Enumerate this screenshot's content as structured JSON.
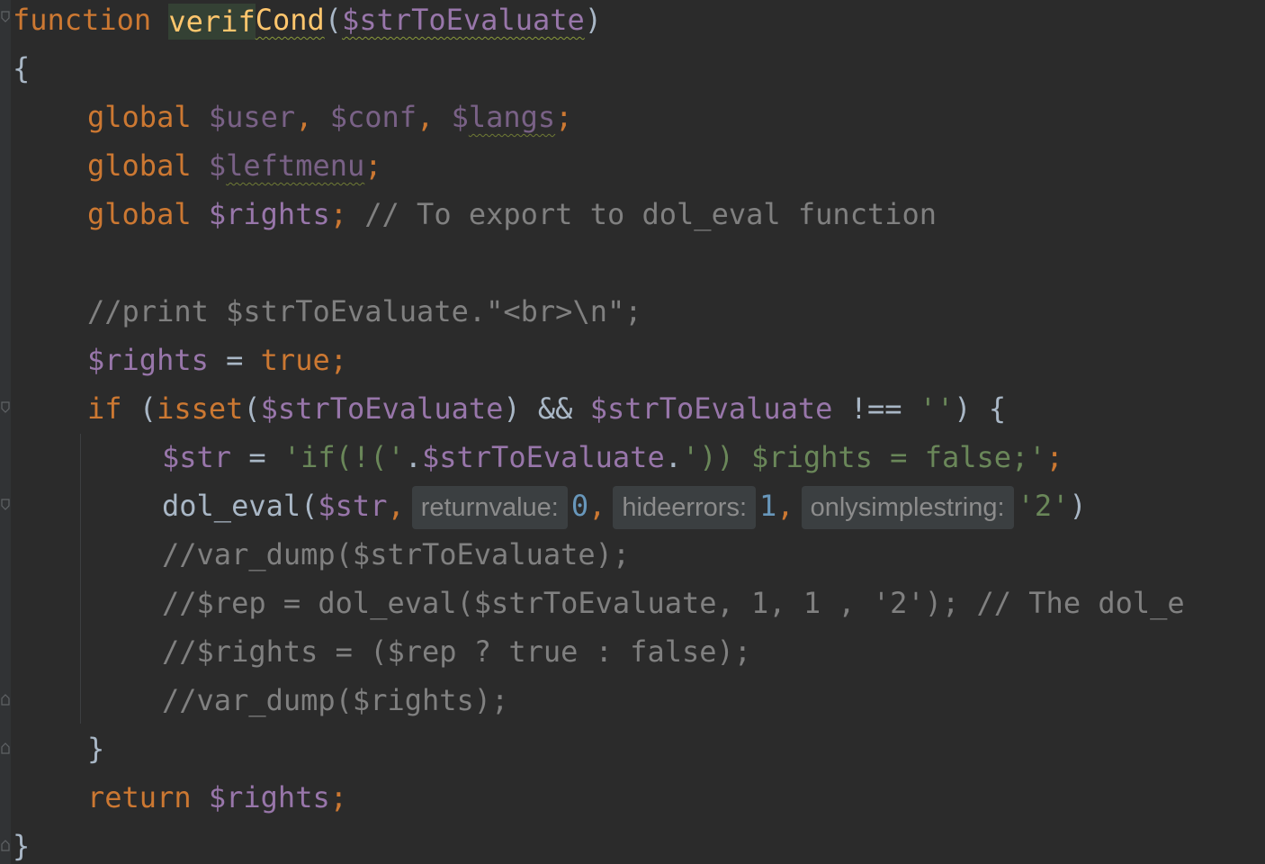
{
  "editor": {
    "background": "#2b2b2b",
    "colors": {
      "keyword": "#cc7832",
      "function_name": "#ffc66d",
      "variable": "#9876aa",
      "string": "#6a8759",
      "number": "#6897bb",
      "comment": "#808080",
      "default": "#a9b7c6"
    },
    "code": {
      "l1": {
        "kw": "function",
        "fname_a": "verif",
        "fname_b": "Cond",
        "open": "(",
        "param": "$strToEvaluate",
        "close": ")"
      },
      "l2": {
        "brace": "{"
      },
      "l3": {
        "kw": "global",
        "v1": "$user",
        "sep1": ", ",
        "v2": "$conf",
        "sep2": ", ",
        "v3_dollar": "$",
        "v3_name": "langs",
        "semi": ";"
      },
      "l4": {
        "kw": "global",
        "v_dollar": "$",
        "v_name": "leftmenu",
        "semi": ";"
      },
      "l5": {
        "kw": "global",
        "v": "$rights",
        "semi": ";",
        "comment": "// To export to dol_eval function"
      },
      "l6": {
        "comment": "//print $strToEvaluate.\"<br>\\n\";"
      },
      "l7": {
        "v": "$rights",
        "op": " = ",
        "val": "true",
        "semi": ";"
      },
      "l8": {
        "kw": "if",
        "p1": " (",
        "fn": "isset",
        "p2": "(",
        "v1": "$strToEvaluate",
        "p3": ") && ",
        "v2": "$strToEvaluate",
        "p4": " !== ",
        "s": "''",
        "p5": ") {"
      },
      "l9": {
        "v": "$str",
        "op": " = ",
        "s1": "'if(!('",
        "dot1": ".",
        "v2": "$strToEvaluate",
        "dot2": ".",
        "s2": "')) $rights = false;'",
        "semi": ";"
      },
      "l10": {
        "fn": "dol_eval",
        "p1": "(",
        "v": "$str",
        "c1": ",",
        "hint1": "returnvalue:",
        "n1": "0",
        "c2": ",",
        "hint2": "hideerrors:",
        "n2": "1",
        "c3": ",",
        "hint3": "onlysimplestring:",
        "s": "'2'",
        "p2": ")"
      },
      "l11": {
        "comment": "//var_dump($strToEvaluate);"
      },
      "l12": {
        "comment": "//$rep = dol_eval($strToEvaluate, 1, 1 , '2'); // The dol_e"
      },
      "l13": {
        "comment": "//$rights = ($rep ? true : false);"
      },
      "l14": {
        "comment": "//var_dump($rights);"
      },
      "l15": {
        "brace": "}"
      },
      "l16": {
        "kw": "return",
        "v": "$rights",
        "semi": ";"
      },
      "l17": {
        "brace": "}"
      }
    }
  }
}
